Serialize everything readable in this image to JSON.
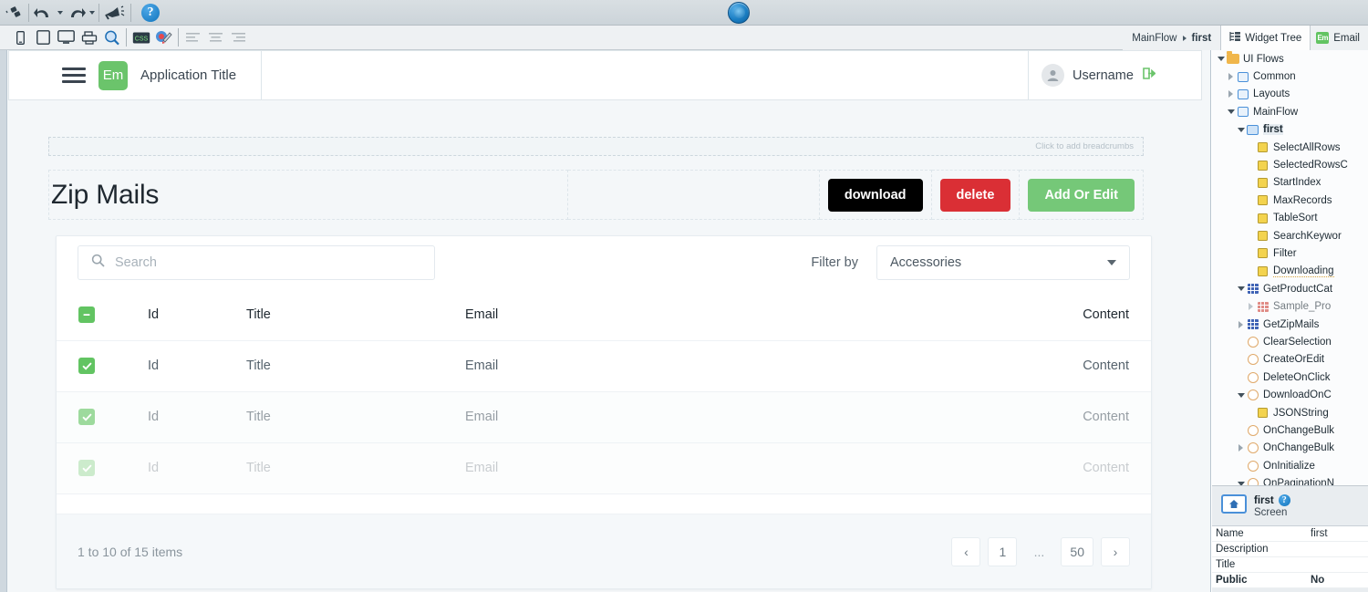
{
  "ide": {
    "toolbar": {
      "icons": [
        "clone-icon",
        "undo-icon",
        "undo-dropdown-icon",
        "redo-icon",
        "redo-dropdown-icon",
        "publish-announce-icon",
        "help-icon"
      ],
      "publish_button": "publish-button",
      "help_label": "?"
    },
    "sub_toolbar": {
      "device_icons": [
        "phone-preview-icon",
        "tablet-preview-icon",
        "desktop-preview-icon",
        "print-preview-icon",
        "zoom-preview-icon",
        "css-editor-icon",
        "theme-brush-icon"
      ],
      "align_icons": [
        "align-left-icon",
        "align-center-icon",
        "align-right-icon"
      ]
    },
    "breadcrumb": {
      "root": "MainFlow",
      "current": "first"
    },
    "tabs": [
      {
        "label": "Widget Tree",
        "icon": "widget-tree-icon",
        "active": true
      },
      {
        "label": "Email",
        "icon": "module-email-icon",
        "active": false
      }
    ]
  },
  "preview": {
    "header": {
      "menu_icon": "hamburger-menu-icon",
      "logo_text": "Em",
      "app_title": "Application Title",
      "avatar_icon": "user-avatar-icon",
      "username": "Username",
      "logout_icon": "logout-icon"
    },
    "breadcrumb_placeholder": "Click to add breadcrumbs",
    "page_title": "Zip Mails",
    "buttons": {
      "download": "download",
      "delete": "delete",
      "add_or_edit": "Add Or Edit"
    },
    "search": {
      "icon": "search-icon",
      "placeholder": "Search",
      "value": ""
    },
    "filter": {
      "label": "Filter by",
      "selected": "Accessories",
      "chevron": "chevron-down-icon"
    },
    "table": {
      "select_all": {
        "name": "select-all-checkbox",
        "state": "indeterminate"
      },
      "columns": [
        "",
        "Id",
        "Title",
        "Email",
        "Content"
      ],
      "rows": [
        {
          "checked": true,
          "id": "Id",
          "title": "Title",
          "email": "Email",
          "content": "Content"
        },
        {
          "checked": true,
          "id": "Id",
          "title": "Title",
          "email": "Email",
          "content": "Content"
        },
        {
          "checked": true,
          "id": "Id",
          "title": "Title",
          "email": "Email",
          "content": "Content"
        }
      ]
    },
    "footer": {
      "count_text": "1 to 10 of 15 items",
      "pager": [
        "‹",
        "1",
        "...",
        "50",
        "›"
      ]
    },
    "colors": {
      "download_bg": "#000000",
      "delete_bg": "#da2f35",
      "add_edit_bg": "#75c878",
      "checkbox_green": "#62c462",
      "logo_green": "#6bc46b"
    }
  },
  "widget_tree": {
    "nodes": [
      {
        "label": "UI Flows",
        "depth": 0,
        "icon": "folder-icon",
        "twisty": "open",
        "selected": false
      },
      {
        "label": "Common",
        "depth": 1,
        "icon": "flow-icon",
        "twisty": "closed",
        "selected": false
      },
      {
        "label": "Layouts",
        "depth": 1,
        "icon": "flow-icon",
        "twisty": "closed",
        "selected": false
      },
      {
        "label": "MainFlow",
        "depth": 1,
        "icon": "flow-icon",
        "twisty": "open",
        "selected": false
      },
      {
        "label": "first",
        "depth": 2,
        "icon": "screen-icon",
        "twisty": "open",
        "selected": true
      },
      {
        "label": "SelectAllRows",
        "depth": 3,
        "icon": "variable-icon",
        "twisty": "none",
        "selected": false
      },
      {
        "label": "SelectedRowsC",
        "depth": 3,
        "icon": "variable-icon",
        "twisty": "none",
        "selected": false
      },
      {
        "label": "StartIndex",
        "depth": 3,
        "icon": "variable-icon",
        "twisty": "none",
        "selected": false
      },
      {
        "label": "MaxRecords",
        "depth": 3,
        "icon": "variable-icon",
        "twisty": "none",
        "selected": false
      },
      {
        "label": "TableSort",
        "depth": 3,
        "icon": "variable-icon",
        "twisty": "none",
        "selected": false
      },
      {
        "label": "SearchKeywor",
        "depth": 3,
        "icon": "variable-icon",
        "twisty": "none",
        "selected": false
      },
      {
        "label": "Filter",
        "depth": 3,
        "icon": "variable-icon",
        "twisty": "none",
        "selected": false
      },
      {
        "label": "Downloading",
        "depth": 3,
        "icon": "variable-icon",
        "twisty": "none",
        "selected": false,
        "underline": true
      },
      {
        "label": "GetProductCat",
        "depth": 2,
        "icon": "aggregate-icon",
        "twisty": "open",
        "selected": false
      },
      {
        "label": "Sample_Pro",
        "depth": 3,
        "icon": "aggregate-red-icon",
        "twisty": "closed",
        "selected": false,
        "dim": true
      },
      {
        "label": "GetZipMails",
        "depth": 2,
        "icon": "aggregate-icon",
        "twisty": "closed",
        "selected": false
      },
      {
        "label": "ClearSelection",
        "depth": 2,
        "icon": "action-icon",
        "twisty": "none",
        "selected": false
      },
      {
        "label": "CreateOrEdit",
        "depth": 2,
        "icon": "action-icon",
        "twisty": "none",
        "selected": false
      },
      {
        "label": "DeleteOnClick",
        "depth": 2,
        "icon": "action-icon",
        "twisty": "none",
        "selected": false
      },
      {
        "label": "DownloadOnC",
        "depth": 2,
        "icon": "action-icon",
        "twisty": "open",
        "selected": false
      },
      {
        "label": "JSONString",
        "depth": 3,
        "icon": "variable-icon",
        "twisty": "none",
        "selected": false
      },
      {
        "label": "OnChangeBulk",
        "depth": 2,
        "icon": "action-icon",
        "twisty": "none",
        "selected": false
      },
      {
        "label": "OnChangeBulk",
        "depth": 2,
        "icon": "action-icon",
        "twisty": "closed",
        "selected": false
      },
      {
        "label": "OnInitialize",
        "depth": 2,
        "icon": "action-icon",
        "twisty": "none",
        "selected": false
      },
      {
        "label": "OnPaginationN",
        "depth": 2,
        "icon": "action-icon",
        "twisty": "open",
        "selected": false
      }
    ]
  },
  "properties": {
    "icon": "screen-home-icon",
    "title": "first",
    "help_glyph": "?",
    "subtitle": "Screen",
    "rows": [
      {
        "key": "Name",
        "value": "first",
        "bold": false
      },
      {
        "key": "Description",
        "value": "",
        "bold": false
      },
      {
        "key": "Title",
        "value": "",
        "bold": false
      },
      {
        "key": "Public",
        "value": "No",
        "bold": true
      }
    ]
  }
}
